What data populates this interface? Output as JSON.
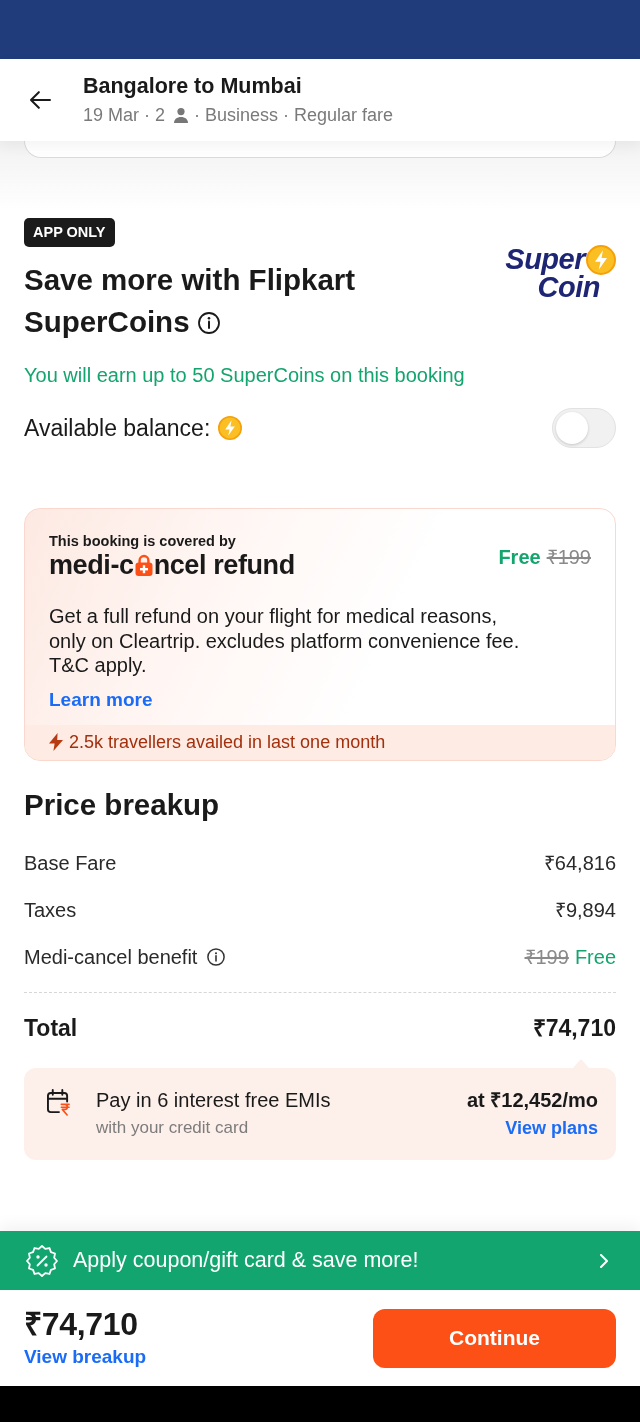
{
  "header": {
    "title": "Bangalore to Mumbai",
    "subtitle_before_icon": "19 Mar · 2",
    "subtitle_after_icon": "· Business · Regular fare"
  },
  "supercoins": {
    "badge": "APP ONLY",
    "title": "Save more with Flipkart SuperCoins",
    "logo": {
      "line_1": "Super",
      "line_2": "Coin"
    },
    "earn_note": "You will earn up to 50 SuperCoins on this booking",
    "balance_label": "Available balance:",
    "toggle": {
      "on": false
    }
  },
  "medi_cancel": {
    "intro": "This booking is covered by",
    "brand_before_icon": "medi-c",
    "brand_after_icon": "ncel refund",
    "offer_price": "Free",
    "original_price": "₹199",
    "description": "Get a full refund on your flight for medical reasons, only on Cleartrip. excludes platform convenience fee. T&C apply.",
    "link": "Learn more",
    "social_proof": "2.5k travellers availed in last one month"
  },
  "price_breakup": {
    "title": "Price breakup",
    "rows": [
      {
        "kind": "amount",
        "label": "Base Fare",
        "info": false,
        "value": "₹64,816"
      },
      {
        "kind": "amount",
        "label": "Taxes",
        "info": false,
        "value": "₹9,894"
      },
      {
        "kind": "benefit",
        "label": "Medi-cancel benefit",
        "info": true,
        "original_value": "₹199",
        "value": "Free"
      }
    ],
    "total": {
      "label": "Total",
      "value": "₹74,710"
    }
  },
  "emi": {
    "title": "Pay in 6 interest free EMIs",
    "subtitle": "with your credit card",
    "amount": "at ₹12,452/mo",
    "link": "View plans"
  },
  "coupon_bar": {
    "text": "Apply coupon/gift card & save more!"
  },
  "footer": {
    "total": "₹74,710",
    "link": "View breakup",
    "button": "Continue"
  }
}
